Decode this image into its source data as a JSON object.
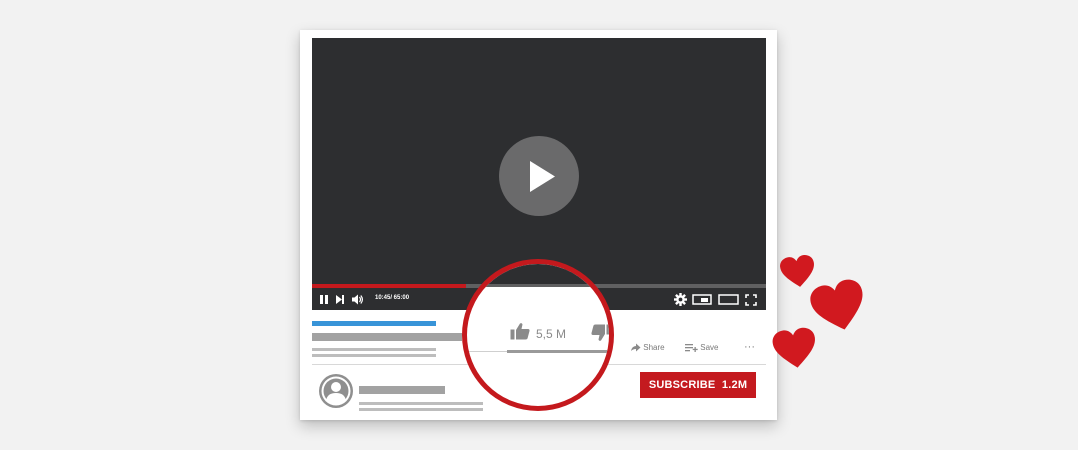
{
  "player": {
    "state": "paused",
    "time_display": "10:45/ 65:00",
    "progress_fraction": 0.34,
    "colors": {
      "background": "#2d2e30",
      "accent": "#c4191d",
      "button": "#6a6a6b"
    },
    "icons": [
      "play-icon",
      "pause-icon",
      "next-icon",
      "volume-icon",
      "settings-icon",
      "miniplayer-icon",
      "theater-icon",
      "fullscreen-icon"
    ]
  },
  "actions": {
    "like_count": "5,5 M",
    "share_label": "Share",
    "save_label": "Save",
    "more_label": "···",
    "icons": [
      "thumbs-up-icon",
      "thumbs-down-icon",
      "share-icon",
      "save-icon"
    ]
  },
  "channel": {
    "subscribe_label": "SUBSCRIBE",
    "subscriber_count": "1.2M",
    "colors": {
      "subscribe": "#c41a1f",
      "title_bar": "#3894d8"
    }
  },
  "decoration": {
    "hearts": 3,
    "heart_color": "#d1191f"
  }
}
